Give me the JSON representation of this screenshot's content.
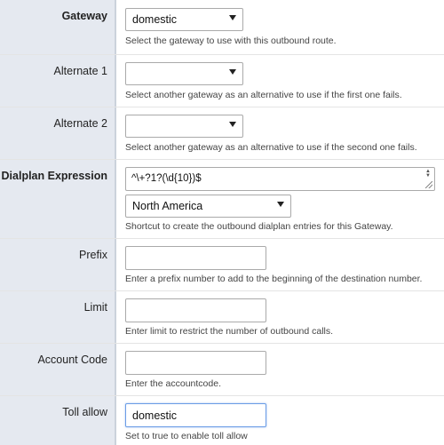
{
  "gateway": {
    "label": "Gateway",
    "value": "domestic",
    "help": "Select the gateway to use with this outbound route."
  },
  "alternate1": {
    "label": "Alternate 1",
    "value": "",
    "help": "Select another gateway as an alternative to use if the first one fails."
  },
  "alternate2": {
    "label": "Alternate 2",
    "value": "",
    "help": "Select another gateway as an alternative to use if the second one fails."
  },
  "dialplan": {
    "label": "Dialplan Expression",
    "expression": "^\\+?1?(\\d{10})$",
    "shortcut_value": "North America",
    "help": "Shortcut to create the outbound dialplan entries for this Gateway."
  },
  "prefix": {
    "label": "Prefix",
    "value": "",
    "help": "Enter a prefix number to add to the beginning of the destination number."
  },
  "limit": {
    "label": "Limit",
    "value": "",
    "help": "Enter limit to restrict the number of outbound calls."
  },
  "account_code": {
    "label": "Account Code",
    "value": "",
    "help": "Enter the accountcode."
  },
  "toll_allow": {
    "label": "Toll allow",
    "value": "domestic",
    "help": "Set to true to enable toll allow"
  },
  "colors": {
    "label_bg": "#e5e9f0",
    "label_border": "#cbd2dc",
    "focus_border": "#6b9de6"
  }
}
